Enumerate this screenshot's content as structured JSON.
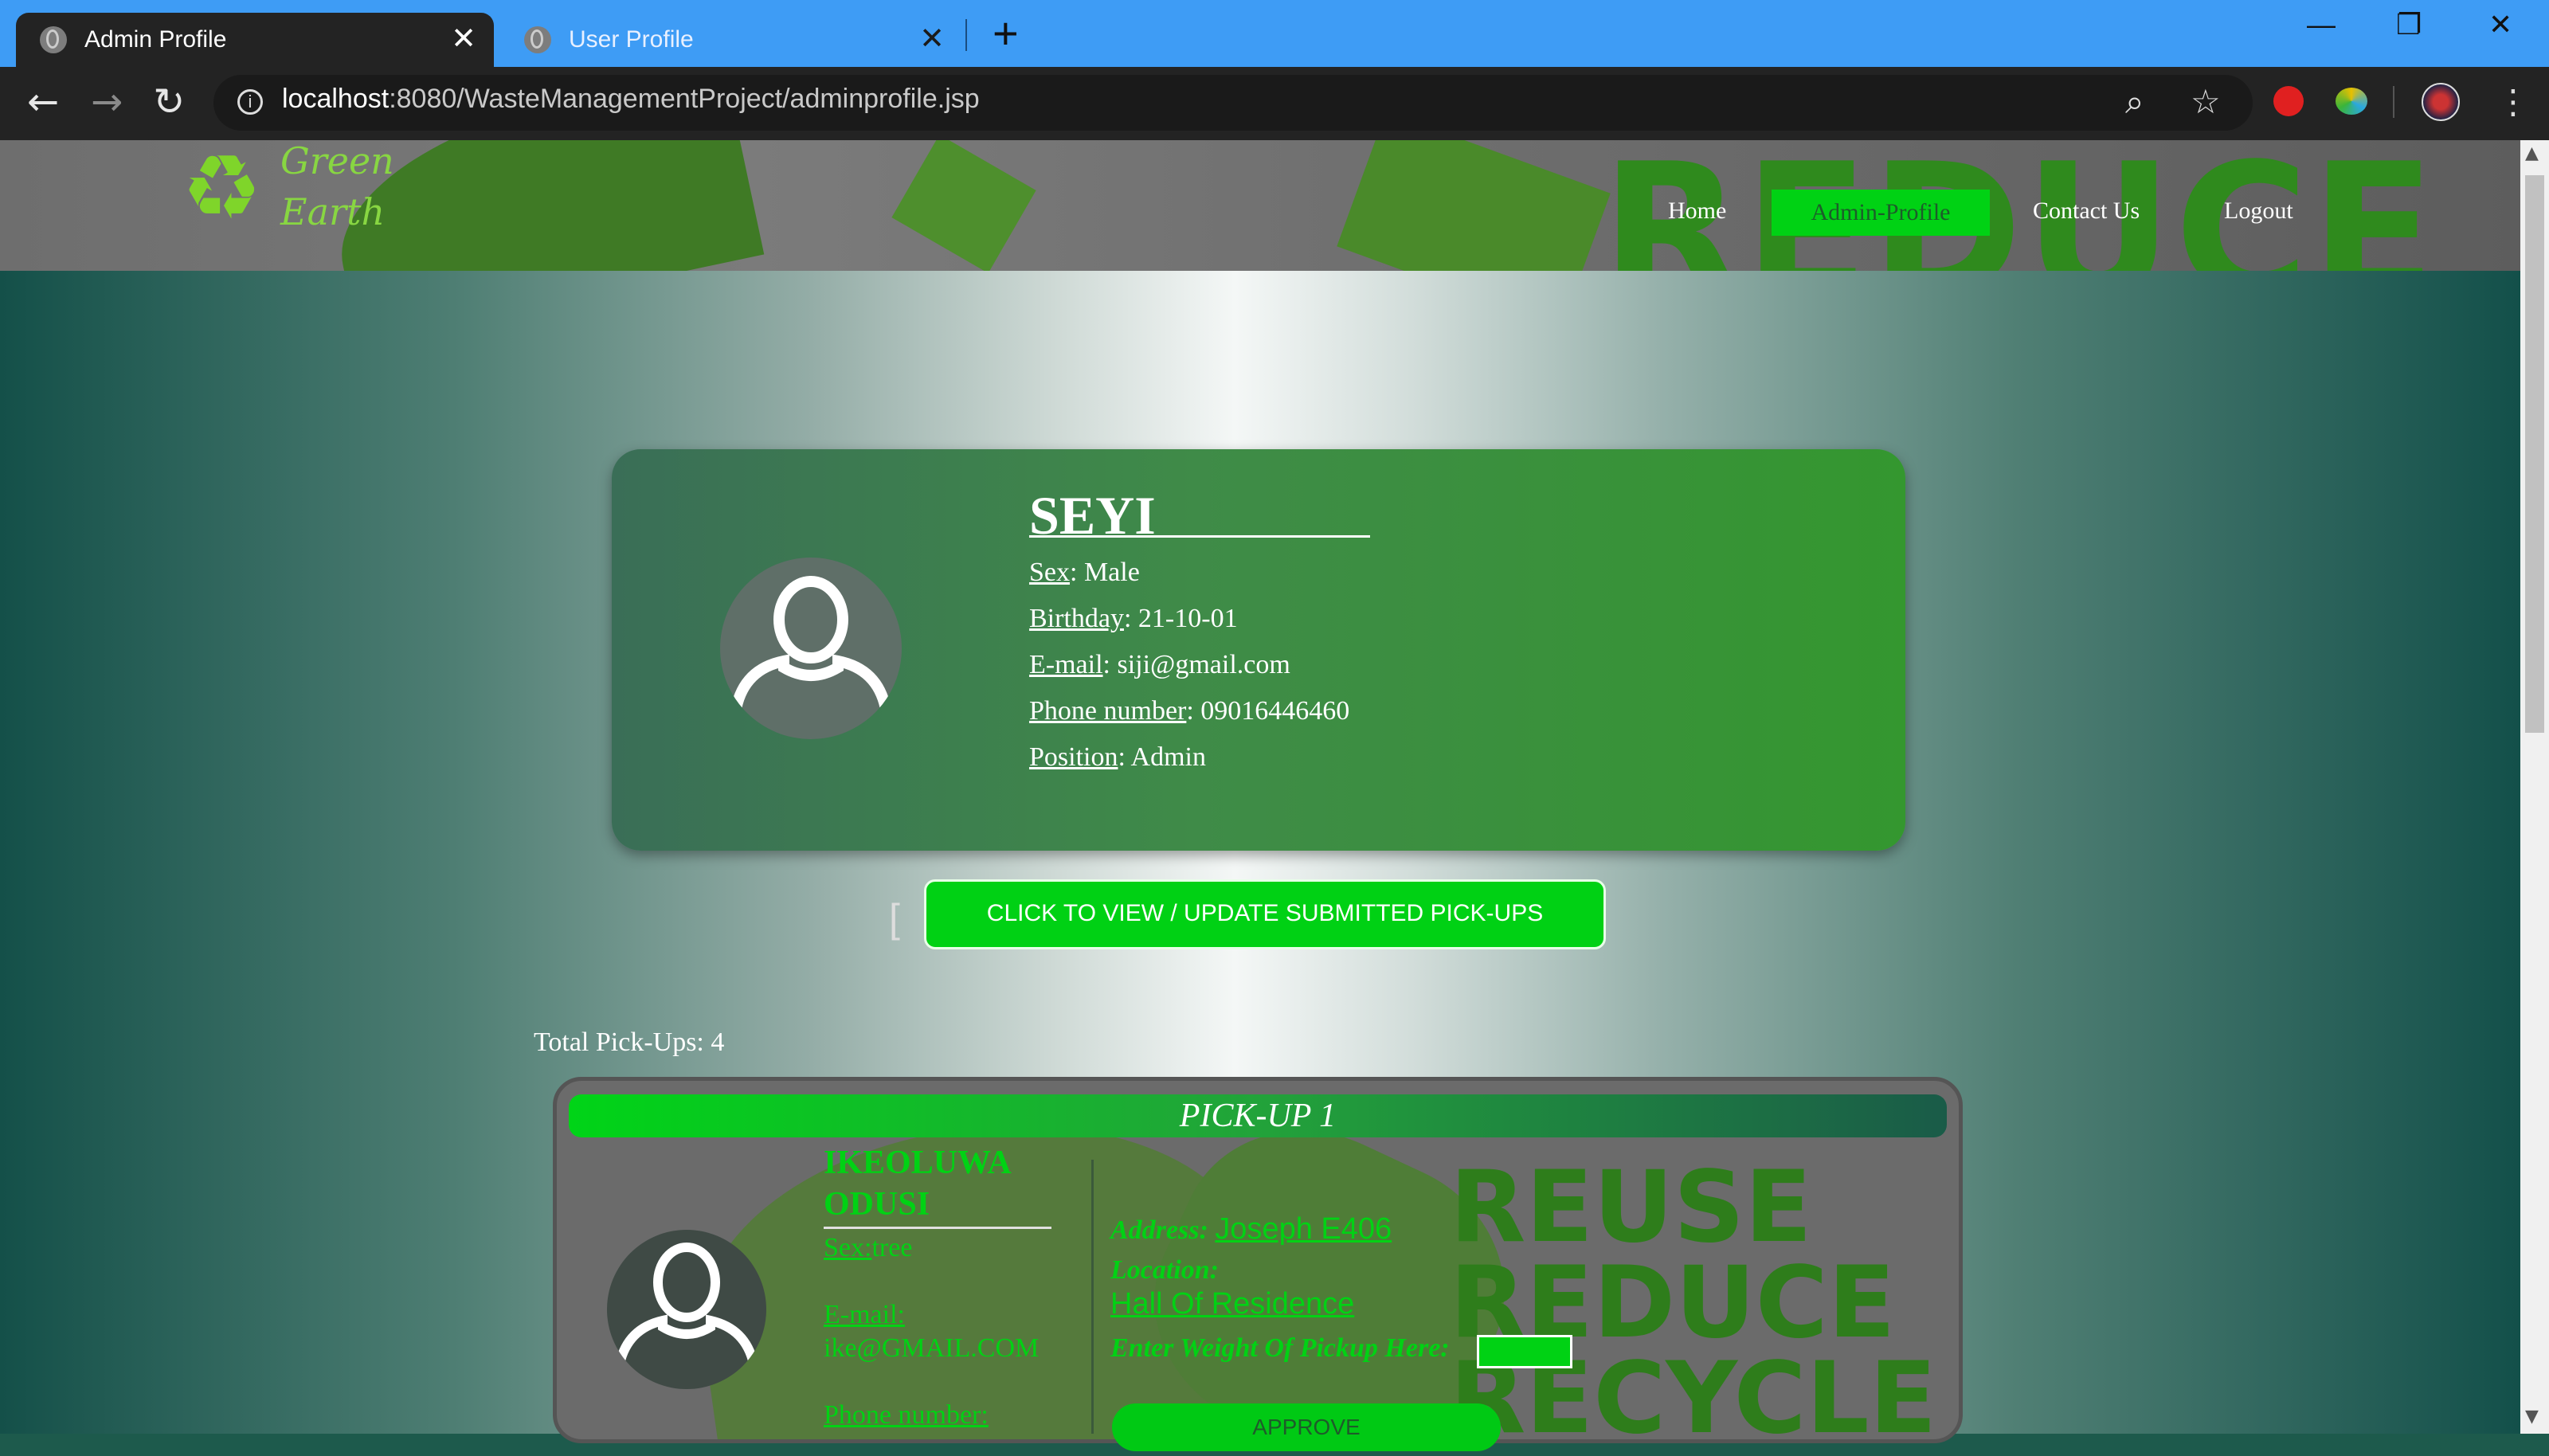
{
  "browser": {
    "tabs": [
      {
        "title": "Admin Profile",
        "active": true
      },
      {
        "title": "User Profile",
        "active": false
      }
    ],
    "new_tab_icon": "+",
    "url_host": "localhost",
    "url_rest": ":8080/WasteManagementProject/adminprofile.jsp",
    "icons": {
      "back": "←",
      "forward": "→",
      "reload": "↻",
      "zoom": "⌕",
      "star": "☆",
      "menu": "⋮",
      "minimize": "—",
      "restore": "❐",
      "close": "✕",
      "tab_close": "✕"
    }
  },
  "site": {
    "logo_text_line1": "Green",
    "logo_text_line2": "Earth",
    "logo_icon": "♻",
    "header_bg_text": "REDUCE",
    "nav": [
      "Home",
      "Admin-Profile",
      "Contact Us",
      "Logout"
    ],
    "active_nav": "Admin-Profile",
    "colors": {
      "accent": "#00d214",
      "header_bg": "#6e6e6e"
    }
  },
  "profile": {
    "name": "SEYI",
    "fields": [
      {
        "label": "Sex",
        "value": ": Male"
      },
      {
        "label": "Birthday",
        "value": ": 21-10-01"
      },
      {
        "label": "E-mail",
        "value": ": siji@gmail.com"
      },
      {
        "label": "Phone number",
        "value": ": 09016446460"
      },
      {
        "label": "Position",
        "value": ": Admin"
      }
    ]
  },
  "actions": {
    "bracket": "[",
    "view_button": "CLICK TO VIEW / UPDATE SUBMITTED PICK-UPS"
  },
  "pickups": {
    "total_text": "Total Pick-Ups: 4",
    "items": [
      {
        "title": "PICK-UP 1",
        "name_line1": "IKEOLUWA",
        "name_line2": "ODUSI",
        "sex_label": "Sex:",
        "sex_value": "tree",
        "email_label": "E-mail:",
        "email_value": "ike@GMAIL.COM",
        "phone_label": "Phone number:",
        "address_label": "Address:",
        "address_value": "Joseph E406",
        "location_label": "Location:",
        "location_value": "Hall Of Residence",
        "weight_label": "Enter Weight Of Pickup Here:",
        "approve_label": "APPROVE",
        "bg_words": [
          "REUSE",
          "REDUCE",
          "RECYCLE"
        ]
      }
    ]
  }
}
